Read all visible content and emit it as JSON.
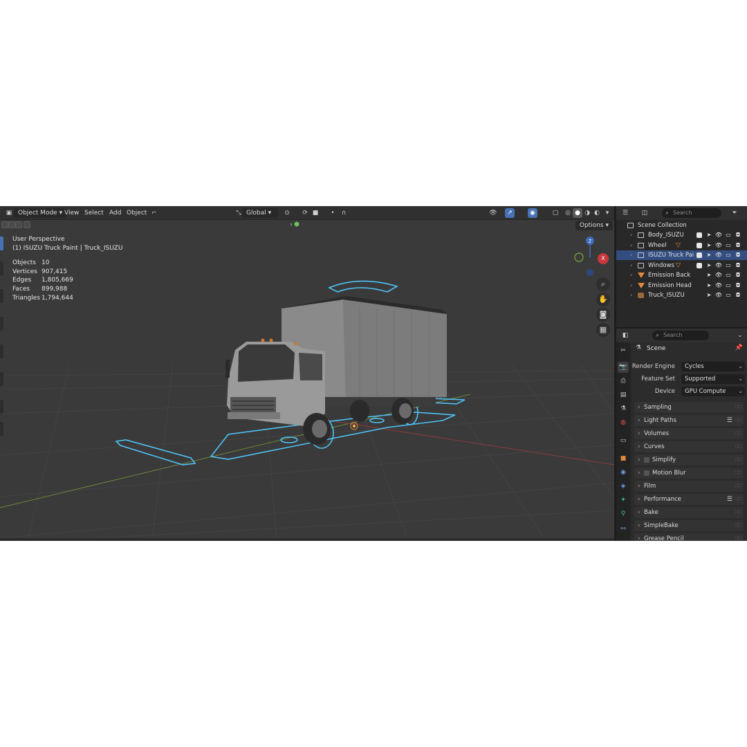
{
  "viewport": {
    "mode": "Object Mode",
    "menus": [
      "View",
      "Select",
      "Add",
      "Object"
    ],
    "orientation": "Global",
    "options_label": "Options",
    "perspective": "User Perspective",
    "active_object": "(1) ISUZU Truck Paint | Truck_ISUZU",
    "stats": [
      {
        "label": "Objects",
        "value": "10"
      },
      {
        "label": "Vertices",
        "value": "907,415"
      },
      {
        "label": "Edges",
        "value": "1,805,669"
      },
      {
        "label": "Faces",
        "value": "899,988"
      },
      {
        "label": "Triangles",
        "value": "1,794,644"
      }
    ],
    "gizmo_axis": "Z",
    "gizmo_x": "X"
  },
  "outliner": {
    "search_placeholder": "Search",
    "root": "Scene Collection",
    "items": [
      {
        "name": "Body_ISUZU",
        "type": "collection",
        "selected": false
      },
      {
        "name": "Wheel",
        "type": "collection",
        "selected": false
      },
      {
        "name": "ISUZU Truck Pair",
        "type": "collection",
        "selected": true
      },
      {
        "name": "Windows",
        "type": "collection",
        "selected": false
      },
      {
        "name": "Emission Back",
        "type": "light",
        "selected": false
      },
      {
        "name": "Emission Head",
        "type": "light",
        "selected": false
      },
      {
        "name": "Truck_ISUZU",
        "type": "armature",
        "selected": false
      }
    ]
  },
  "properties": {
    "search_placeholder": "Search",
    "context": "Scene",
    "fields": [
      {
        "label": "Render Engine",
        "value": "Cycles"
      },
      {
        "label": "Feature Set",
        "value": "Supported"
      },
      {
        "label": "Device",
        "value": "GPU Compute"
      }
    ],
    "sections": [
      {
        "name": "Sampling",
        "checkbox": false,
        "list": false
      },
      {
        "name": "Light Paths",
        "checkbox": false,
        "list": true
      },
      {
        "name": "Volumes",
        "checkbox": false,
        "list": false
      },
      {
        "name": "Curves",
        "checkbox": false,
        "list": false
      },
      {
        "name": "Simplify",
        "checkbox": true,
        "list": false
      },
      {
        "name": "Motion Blur",
        "checkbox": true,
        "list": false
      },
      {
        "name": "Film",
        "checkbox": false,
        "list": false
      },
      {
        "name": "Performance",
        "checkbox": false,
        "list": true
      },
      {
        "name": "Bake",
        "checkbox": false,
        "list": false
      },
      {
        "name": "SimpleBake",
        "checkbox": false,
        "list": false
      },
      {
        "name": "Grease Pencil",
        "checkbox": false,
        "list": false
      }
    ]
  },
  "colors": {
    "accent": "#4772b3",
    "selected_row": "#334d80",
    "outline": "#4fc3f7",
    "light_icon": "#e08a3c"
  }
}
